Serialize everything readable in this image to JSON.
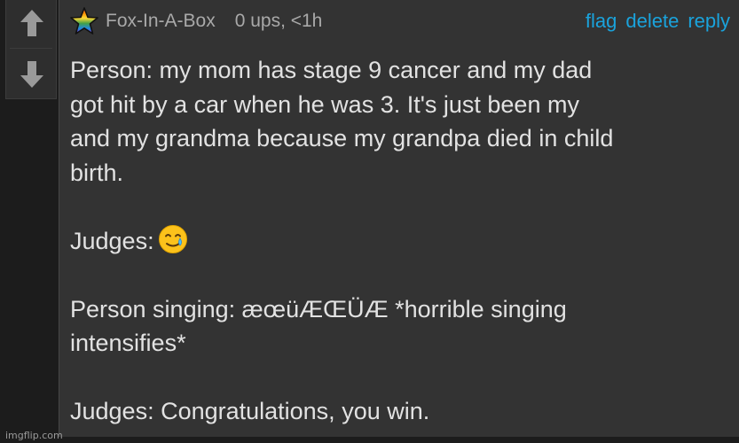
{
  "vote": {
    "up_icon": "arrow-up-icon",
    "down_icon": "arrow-down-icon"
  },
  "comment": {
    "avatar_icon": "rainbow-star-icon",
    "username": "Fox-In-A-Box",
    "meta": "0 ups, <1h",
    "actions": {
      "flag": "flag",
      "delete": "delete",
      "reply": "reply"
    },
    "body": {
      "line1": "Person: my mom has stage 9 cancer and my dad",
      "line2": "got hit by a car when he was 3. It's just been my",
      "line3": "and my grandma because my grandpa died in child",
      "line4": "birth.",
      "judges1": "Judges:",
      "judges1_emoji": "smiling-face-with-tear-emoji",
      "singing1": "Person singing: æœüÆŒÜÆ *horrible singing",
      "singing2": "intensifies*",
      "judges2": "Judges: Congratulations, you win."
    }
  },
  "watermark": "imgflip.com",
  "colors": {
    "background": "#1c1c1c",
    "panel": "#333333",
    "link": "#1aa3dc",
    "text": "#e2e2e2",
    "muted": "#a9a9a9"
  }
}
